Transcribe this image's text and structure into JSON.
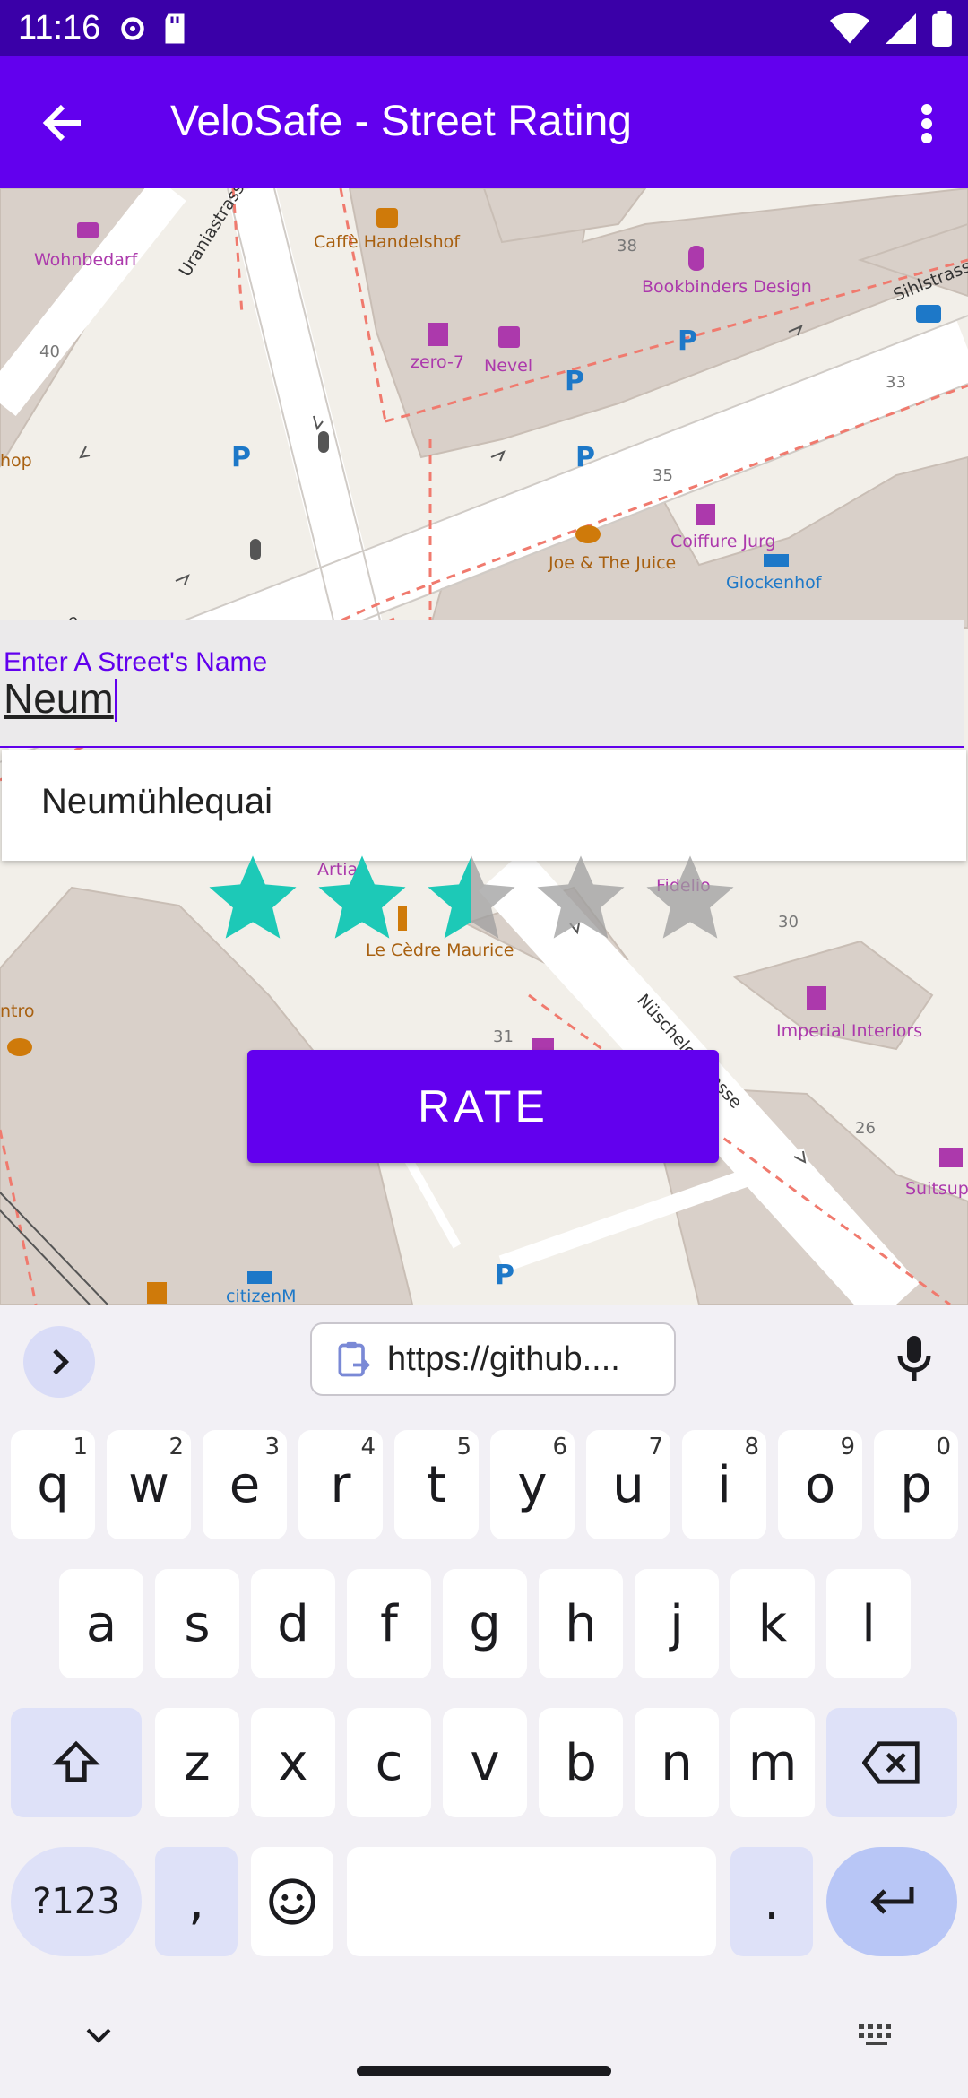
{
  "status_bar": {
    "time": "11:16"
  },
  "app_bar": {
    "title": "VeloSafe - Street Rating"
  },
  "map": {
    "labels": [
      "Wohnbedarf",
      "Caffè Handelshof",
      "Uraniastrasse",
      "zero-7",
      "Nevel",
      "Bookbinders Design",
      "Sihlstrasse",
      "Joe & The Juice",
      "Coiffure Jurg",
      "Glockenhof",
      "Le Cèdre Maurice",
      "Artia",
      "Fidelio",
      "Imperial Interiors",
      "Nüschelerstrasse",
      "Suitsup",
      "citizenM",
      "hop",
      "ntro",
      "sse",
      "38",
      "40",
      "33",
      "35",
      "30",
      "31",
      "26"
    ]
  },
  "search": {
    "label": "Enter A Street's Name",
    "value": "Neum"
  },
  "suggestions": [
    "Neumühlequai"
  ],
  "rating": {
    "value": 2.5,
    "max": 5,
    "fill_color": "#1dc9b7",
    "empty_color": "#9e9e9e"
  },
  "rate_button": {
    "label": "RATE"
  },
  "keyboard": {
    "clipboard_text": "https://github....",
    "row1": [
      {
        "k": "q",
        "h": "1"
      },
      {
        "k": "w",
        "h": "2"
      },
      {
        "k": "e",
        "h": "3"
      },
      {
        "k": "r",
        "h": "4"
      },
      {
        "k": "t",
        "h": "5"
      },
      {
        "k": "y",
        "h": "6"
      },
      {
        "k": "u",
        "h": "7"
      },
      {
        "k": "i",
        "h": "8"
      },
      {
        "k": "o",
        "h": "9"
      },
      {
        "k": "p",
        "h": "0"
      }
    ],
    "row2": [
      "a",
      "s",
      "d",
      "f",
      "g",
      "h",
      "j",
      "k",
      "l"
    ],
    "row3": [
      "z",
      "x",
      "c",
      "v",
      "b",
      "n",
      "m"
    ],
    "sym_label": "?123",
    "comma": ",",
    "period": "."
  },
  "colors": {
    "primary": "#6200ee",
    "status": "#3a00a8",
    "accent_teal": "#1dc9b7"
  }
}
